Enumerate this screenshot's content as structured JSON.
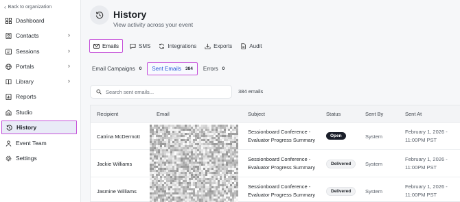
{
  "sidebar": {
    "back_label": "Back to organization",
    "items": [
      {
        "label": "Dashboard",
        "icon": "grid-icon",
        "arrow": false
      },
      {
        "label": "Contacts",
        "icon": "contacts-icon",
        "arrow": true
      },
      {
        "label": "Sessions",
        "icon": "sessions-icon",
        "arrow": true
      },
      {
        "label": "Portals",
        "icon": "globe-icon",
        "arrow": true
      },
      {
        "label": "Library",
        "icon": "book-icon",
        "arrow": true
      },
      {
        "label": "Reports",
        "icon": "reports-icon",
        "arrow": false
      },
      {
        "label": "Studio",
        "icon": "studio-icon",
        "arrow": false
      },
      {
        "label": "History",
        "icon": "history-icon",
        "arrow": false,
        "active": true
      },
      {
        "label": "Event Team",
        "icon": "team-icon",
        "arrow": false
      },
      {
        "label": "Settings",
        "icon": "gear-icon",
        "arrow": false
      }
    ]
  },
  "header": {
    "title": "History",
    "subtitle": "View activity across your event"
  },
  "tabs": [
    {
      "label": "Emails",
      "icon": "mail-icon",
      "active": true
    },
    {
      "label": "SMS",
      "icon": "chat-icon"
    },
    {
      "label": "Integrations",
      "icon": "sync-icon"
    },
    {
      "label": "Exports",
      "icon": "download-icon"
    },
    {
      "label": "Audit",
      "icon": "document-icon"
    }
  ],
  "subtabs": [
    {
      "label": "Email Campaigns",
      "count": "0"
    },
    {
      "label": "Sent Emails",
      "count": "384",
      "active": true
    },
    {
      "label": "Errors",
      "count": "0"
    }
  ],
  "search": {
    "placeholder": "Search sent emails...",
    "count_label": "384 emails"
  },
  "table": {
    "columns": [
      "Recipient",
      "Email",
      "Subject",
      "Status",
      "Sent By",
      "Sent At"
    ],
    "rows": [
      {
        "recipient": "Catrina McDermott",
        "subject_1": "Sessionboard Conference -",
        "subject_2": "Evaluator Progress Summary",
        "status": "Open",
        "sent_by": "System",
        "sent_at_1": "February 1, 2026 -",
        "sent_at_2": "11:00PM PST"
      },
      {
        "recipient": "Jackie Williams",
        "subject_1": "Sessionboard Conference -",
        "subject_2": "Evaluator Progress Summary",
        "status": "Delivered",
        "sent_by": "System",
        "sent_at_1": "February 1, 2026 -",
        "sent_at_2": "11:00PM PST"
      },
      {
        "recipient": "Jasmine Williams",
        "subject_1": "Sessionboard Conference -",
        "subject_2": "Evaluator Progress Summary",
        "status": "Delivered",
        "sent_by": "System",
        "sent_at_1": "February 1, 2026 -",
        "sent_at_2": "11:00PM PST"
      }
    ]
  },
  "colors": {
    "highlight_outline": "#c54fd9",
    "active_link": "#2457d6",
    "open_badge": "#1b1f2a",
    "page_bg": "#f6f7f9"
  }
}
